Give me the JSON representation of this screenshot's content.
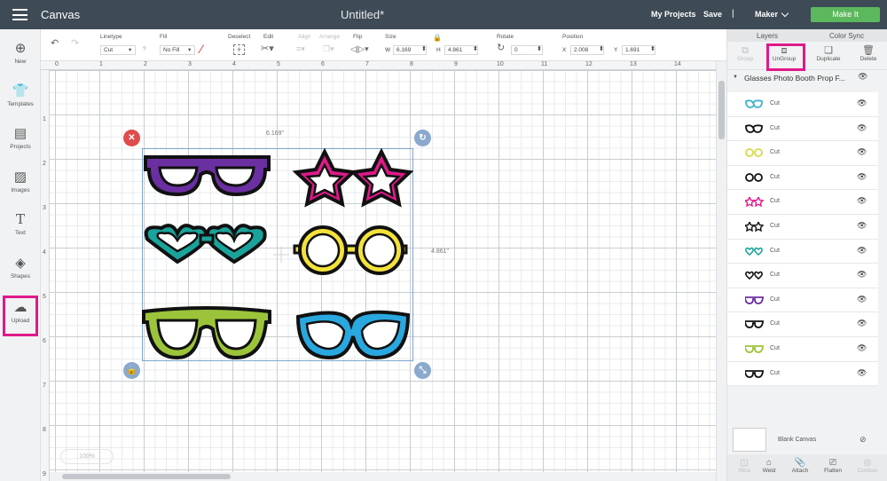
{
  "header": {
    "app_name": "Canvas",
    "doc_title": "Untitled*",
    "my_projects": "My Projects",
    "save": "Save",
    "separator": "|",
    "machine": "Maker",
    "make_it": "Make It"
  },
  "toolbar": {
    "linetype_label": "Linetype",
    "linetype_value": "Cut",
    "fill_label": "Fill",
    "fill_value": "No Fill",
    "deselect_label": "Deselect",
    "edit_label": "Edit",
    "align_label": "Align",
    "arrange_label": "Arrange",
    "flip_label": "Flip",
    "size_label": "Size",
    "size_w_label": "W",
    "size_w": "6.169",
    "size_h_label": "H",
    "size_h": "4.861",
    "rotate_label": "Rotate",
    "rotate_value": "0",
    "position_label": "Position",
    "pos_x_label": "X",
    "pos_x": "2.008",
    "pos_y_label": "Y",
    "pos_y": "1.691"
  },
  "leftbar": {
    "items": [
      {
        "label": "New",
        "icon": "plus-circle-icon"
      },
      {
        "label": "Templates",
        "icon": "shirt-icon"
      },
      {
        "label": "Projects",
        "icon": "projects-icon"
      },
      {
        "label": "Images",
        "icon": "image-icon"
      },
      {
        "label": "Text",
        "icon": "text-icon"
      },
      {
        "label": "Shapes",
        "icon": "shapes-icon"
      },
      {
        "label": "Upload",
        "icon": "upload-icon"
      }
    ]
  },
  "canvas": {
    "ruler_top": [
      "0",
      "1",
      "2",
      "3",
      "4",
      "5",
      "6",
      "7",
      "8",
      "9",
      "10",
      "11",
      "12",
      "13",
      "14"
    ],
    "ruler_left": [
      "1",
      "2",
      "3",
      "4",
      "5",
      "6",
      "7",
      "8",
      "9"
    ],
    "dim_width": "6.169\"",
    "dim_height": "4.861\"",
    "zoom": "100%"
  },
  "right_panel": {
    "tab_layers": "Layers",
    "tab_color_sync": "Color Sync",
    "actions": {
      "group": "Group",
      "ungroup": "UnGroup",
      "duplicate": "Duplicate",
      "delete": "Delete"
    },
    "group_name": "Glasses Photo Booth Prop F...",
    "layers": [
      {
        "op": "Cut",
        "color": "#3fb2cc",
        "shape": "cat"
      },
      {
        "op": "Cut",
        "color": "#111111",
        "shape": "cat"
      },
      {
        "op": "Cut",
        "color": "#d6d94a",
        "shape": "round"
      },
      {
        "op": "Cut",
        "color": "#111111",
        "shape": "round"
      },
      {
        "op": "Cut",
        "color": "#e0198a",
        "shape": "star"
      },
      {
        "op": "Cut",
        "color": "#111111",
        "shape": "star"
      },
      {
        "op": "Cut",
        "color": "#1aa39a",
        "shape": "heart"
      },
      {
        "op": "Cut",
        "color": "#111111",
        "shape": "heart"
      },
      {
        "op": "Cut",
        "color": "#6a2fa0",
        "shape": "rect"
      },
      {
        "op": "Cut",
        "color": "#111111",
        "shape": "rect"
      },
      {
        "op": "Cut",
        "color": "#9bc43a",
        "shape": "rect"
      },
      {
        "op": "Cut",
        "color": "#111111",
        "shape": "rect"
      }
    ],
    "blank_canvas": "Blank Canvas",
    "bottom_actions": {
      "slice": "Slice",
      "weld": "Weld",
      "attach": "Attach",
      "flatten": "Flatten",
      "contour": "Contour"
    }
  },
  "colors": {
    "accent_green": "#5cb85c",
    "highlight_pink": "#e0198a",
    "purple": "#6a2fa0",
    "pink": "#e0198a",
    "teal": "#1aa39a",
    "yellow": "#f3e23a",
    "lime": "#9bc43a",
    "blue": "#29a8e0"
  }
}
